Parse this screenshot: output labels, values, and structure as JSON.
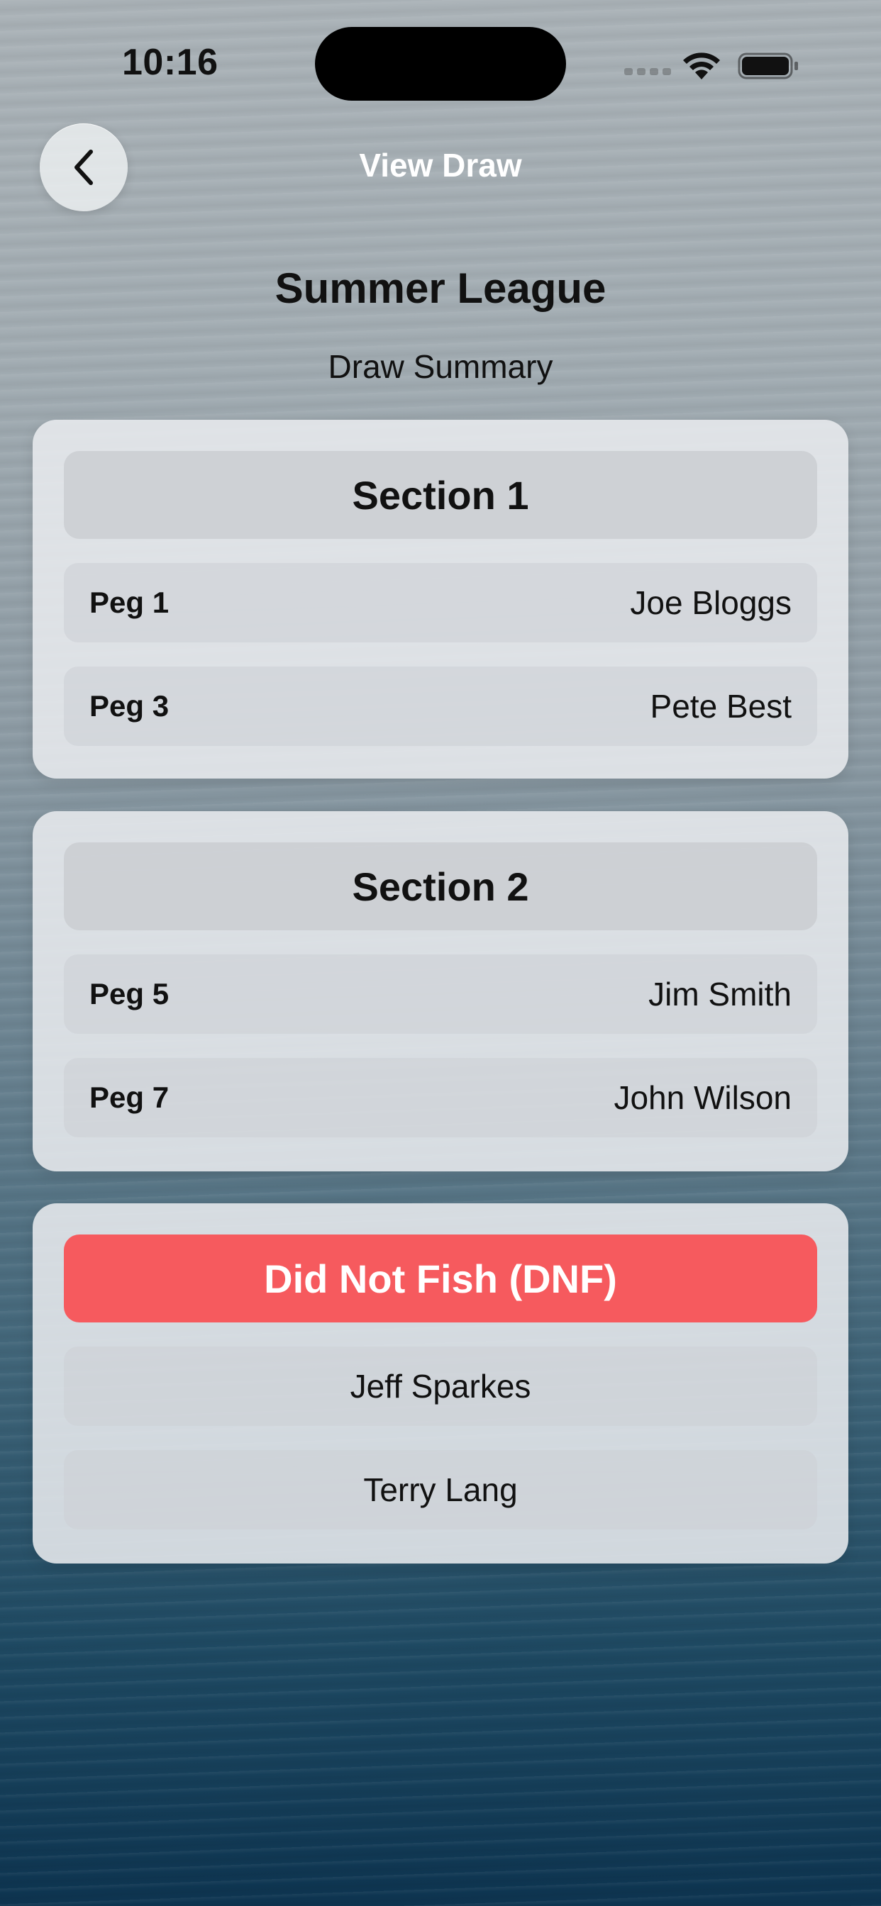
{
  "status_bar": {
    "time": "10:16"
  },
  "nav": {
    "back_icon": "chevron-left-icon",
    "title": "View Draw"
  },
  "header": {
    "title": "Summer League",
    "subtitle": "Draw Summary"
  },
  "sections": [
    {
      "title": "Section 1",
      "rows": [
        {
          "peg": "Peg 1",
          "angler": "Joe Bloggs"
        },
        {
          "peg": "Peg 3",
          "angler": "Pete Best"
        }
      ]
    },
    {
      "title": "Section 2",
      "rows": [
        {
          "peg": "Peg 5",
          "angler": "Jim Smith"
        },
        {
          "peg": "Peg 7",
          "angler": "John Wilson"
        }
      ]
    }
  ],
  "dnf": {
    "title": "Did Not Fish (DNF)",
    "color": "#f65a5e",
    "anglers": [
      "Jeff Sparkes",
      "Terry Lang"
    ]
  }
}
